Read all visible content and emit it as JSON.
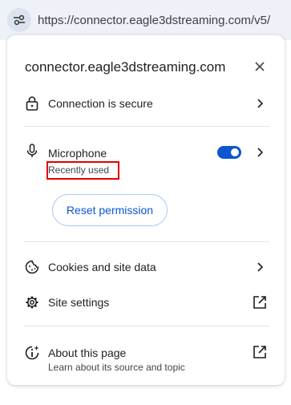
{
  "address_bar": {
    "url": "https://connector.eagle3dstreaming.com/v5/",
    "site_info_icon": "tune-icon"
  },
  "popup": {
    "title": "connector.eagle3dstreaming.com",
    "close_icon": "close-icon",
    "connection": {
      "label": "Connection is secure",
      "icon": "lock-icon"
    },
    "microphone": {
      "label": "Microphone",
      "status": "Recently used",
      "enabled": true,
      "icon": "microphone-icon"
    },
    "reset_button": "Reset permission",
    "cookies": {
      "label": "Cookies and site data",
      "icon": "cookie-icon"
    },
    "site_settings": {
      "label": "Site settings",
      "icon": "gear-icon"
    },
    "about": {
      "label": "About this page",
      "sub": "Learn about its source and topic",
      "icon": "about-icon"
    }
  },
  "colors": {
    "accent": "#0b57d0",
    "highlight_box": "#e10000",
    "address_bar_bg": "#eef1f7"
  }
}
